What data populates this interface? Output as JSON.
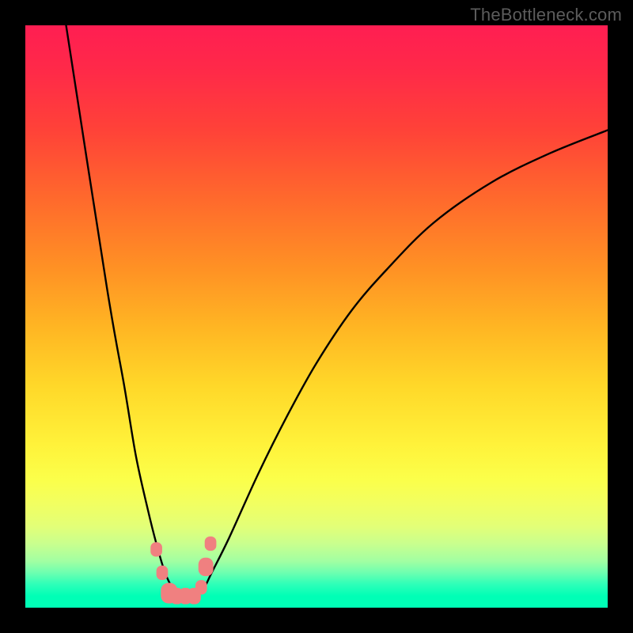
{
  "watermark": "TheBottleneck.com",
  "colors": {
    "frame_bg": "#000000",
    "watermark": "#5c5c5c",
    "curve": "#000000",
    "marker_fill": "#f08080",
    "marker_stroke": "#000000"
  },
  "chart_data": {
    "type": "line",
    "title": "",
    "xlabel": "",
    "ylabel": "",
    "xlim": [
      0,
      100
    ],
    "ylim": [
      0,
      100
    ],
    "grid": false,
    "legend": false,
    "series": [
      {
        "name": "bottleneck-curve",
        "x": [
          7,
          14,
          17,
          19,
          21,
          22.5,
          24,
          25.5,
          27,
          29,
          30.5,
          32,
          35,
          40,
          45,
          50,
          56,
          62,
          70,
          80,
          90,
          100
        ],
        "values": [
          100,
          55,
          38,
          26,
          17,
          11,
          6,
          3,
          1.5,
          1.5,
          3,
          6,
          12,
          23,
          33,
          42,
          51,
          58,
          66,
          73,
          78,
          82
        ]
      }
    ],
    "markers": [
      {
        "x": 22.5,
        "y": 10,
        "size": 3.5
      },
      {
        "x": 23.5,
        "y": 6,
        "size": 3.5
      },
      {
        "x": 24.7,
        "y": 2.5,
        "size": 5
      },
      {
        "x": 26.0,
        "y": 2,
        "size": 4
      },
      {
        "x": 27.5,
        "y": 2,
        "size": 4
      },
      {
        "x": 29.0,
        "y": 2,
        "size": 4
      },
      {
        "x": 30.2,
        "y": 3.5,
        "size": 3.5
      },
      {
        "x": 31.0,
        "y": 7,
        "size": 4.5
      },
      {
        "x": 31.8,
        "y": 11,
        "size": 3.5
      }
    ],
    "background_gradient": {
      "top": "#ff1e52",
      "mid": "#fff23a",
      "bottom": "#00ffb6"
    }
  }
}
